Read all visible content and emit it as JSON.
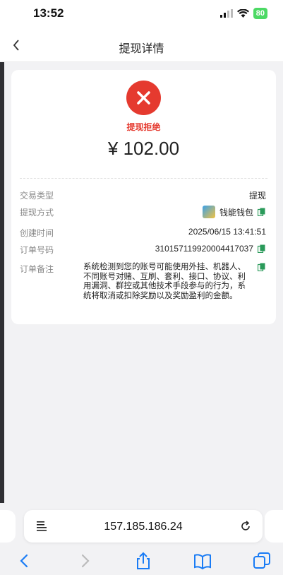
{
  "status_bar": {
    "time": "13:52",
    "battery": "80"
  },
  "nav": {
    "title": "提现详情"
  },
  "summary": {
    "status": "提现拒绝",
    "amount": "¥ 102.00"
  },
  "details": {
    "type_label": "交易类型",
    "type_value": "提现",
    "method_label": "提现方式",
    "method_value": "钱能钱包",
    "time_label": "创建时间",
    "time_value": "2025/06/15 13:41:51",
    "order_label": "订单号码",
    "order_value": "310157119920004417037",
    "remark_label": "订单备注",
    "remark_value": "系统检测到您的账号可能使用外挂、机器人、不同账号对赌、互刷、套利、接口、协议、利用漏洞、群控或其他技术手段参与的行为，系统将取消或扣除奖励以及奖励盈利的金额。"
  },
  "browser": {
    "url": "157.185.186.24"
  },
  "colors": {
    "reject_red": "#e53a2f",
    "ios_blue": "#1a7cf5"
  }
}
